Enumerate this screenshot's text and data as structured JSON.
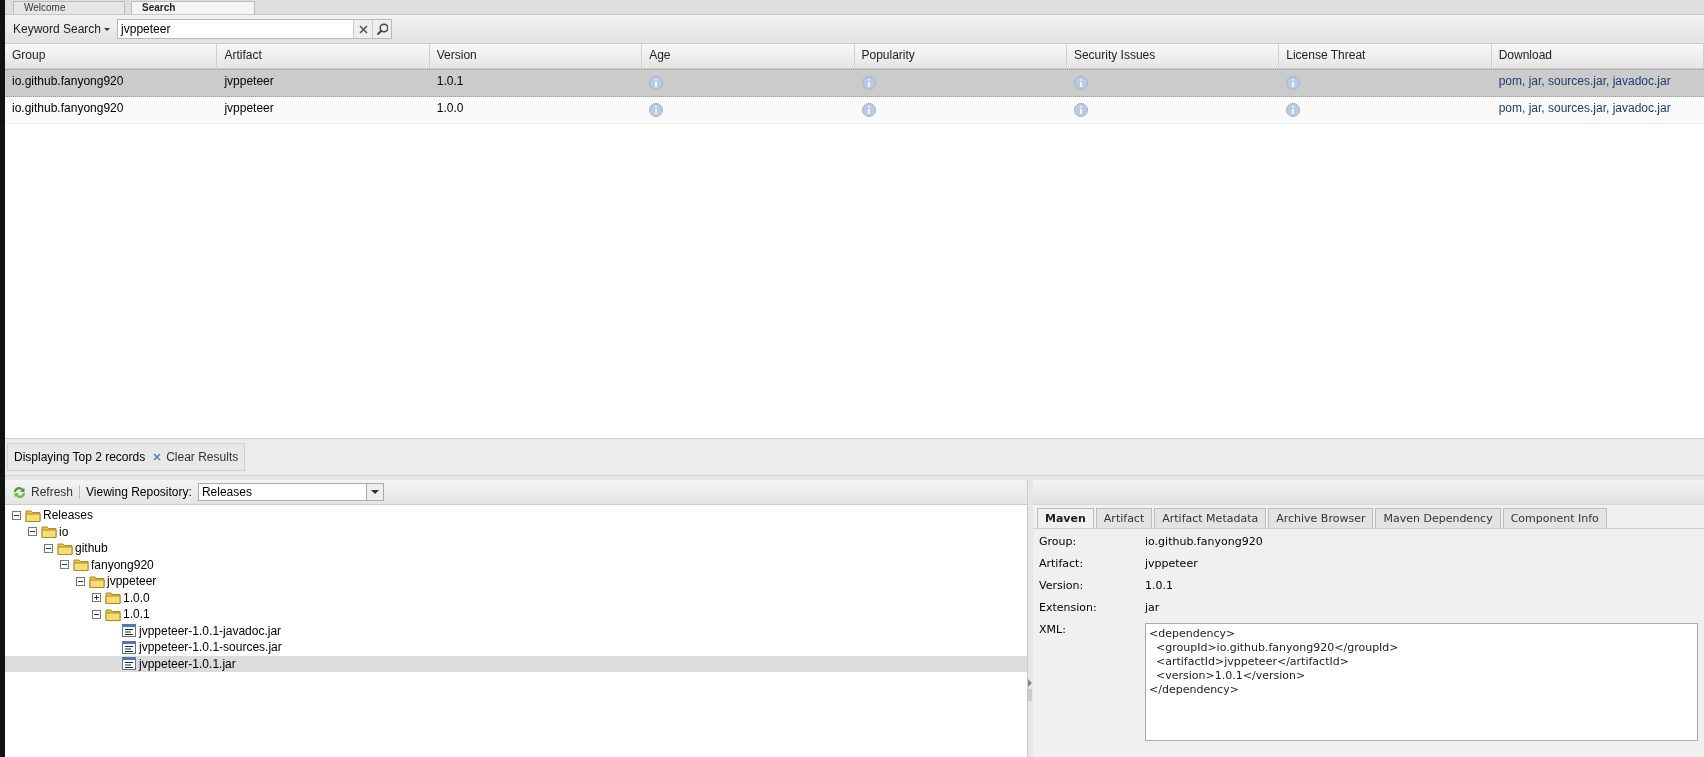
{
  "top_tabs": [
    {
      "label": "Welcome",
      "selected": false
    },
    {
      "label": "Search",
      "selected": true
    }
  ],
  "search": {
    "mode": "Keyword Search",
    "value": "jvppeteer"
  },
  "results": {
    "columns": [
      {
        "label": "Group",
        "kind": "text"
      },
      {
        "label": "Artifact",
        "kind": "text"
      },
      {
        "label": "Version",
        "kind": "text"
      },
      {
        "label": "Age",
        "kind": "info"
      },
      {
        "label": "Popularity",
        "kind": "info"
      },
      {
        "label": "Security Issues",
        "kind": "info"
      },
      {
        "label": "License Threat",
        "kind": "info"
      },
      {
        "label": "Download",
        "kind": "link"
      }
    ],
    "rows": [
      {
        "values": [
          "io.github.fanyong920",
          "jvppeteer",
          "1.0.1",
          "pom, jar, sources.jar, javadoc.jar"
        ],
        "selected": true
      },
      {
        "values": [
          "io.github.fanyong920",
          "jvppeteer",
          "1.0.0",
          "pom, jar, sources.jar, javadoc.jar"
        ],
        "selected": false
      }
    ]
  },
  "paging": {
    "status": "Displaying Top 2 records",
    "clear": "Clear Results"
  },
  "repository": {
    "refresh": "Refresh",
    "label": "Viewing Repository:",
    "value": "Releases"
  },
  "tree": [
    {
      "label": "Releases",
      "kind": "folder",
      "expanded": true,
      "selected": false,
      "children": [
        {
          "label": "io",
          "kind": "folder",
          "expanded": true,
          "selected": false,
          "children": [
            {
              "label": "github",
              "kind": "folder",
              "expanded": true,
              "selected": false,
              "children": [
                {
                  "label": "fanyong920",
                  "kind": "folder",
                  "expanded": true,
                  "selected": false,
                  "children": [
                    {
                      "label": "jvppeteer",
                      "kind": "folder",
                      "expanded": true,
                      "selected": false,
                      "children": [
                        {
                          "label": "1.0.0",
                          "kind": "folder",
                          "expanded": false,
                          "selected": false
                        },
                        {
                          "label": "1.0.1",
                          "kind": "folder",
                          "expanded": true,
                          "selected": false,
                          "children": [
                            {
                              "label": "jvppeteer-1.0.1-javadoc.jar",
                              "kind": "file",
                              "selected": false
                            },
                            {
                              "label": "jvppeteer-1.0.1-sources.jar",
                              "kind": "file",
                              "selected": false
                            },
                            {
                              "label": "jvppeteer-1.0.1.jar",
                              "kind": "file",
                              "selected": true
                            }
                          ]
                        }
                      ]
                    }
                  ]
                }
              ]
            }
          ]
        }
      ]
    }
  ],
  "detail": {
    "tabs": [
      {
        "label": "Maven",
        "selected": true
      },
      {
        "label": "Artifact",
        "selected": false
      },
      {
        "label": "Artifact Metadata",
        "selected": false
      },
      {
        "label": "Archive Browser",
        "selected": false
      },
      {
        "label": "Maven Dependency",
        "selected": false
      },
      {
        "label": "Component Info",
        "selected": false
      }
    ],
    "fields": [
      {
        "label": "Group:",
        "value": "io.github.fanyong920"
      },
      {
        "label": "Artifact:",
        "value": "jvppeteer"
      },
      {
        "label": "Version:",
        "value": "1.0.1"
      },
      {
        "label": "Extension:",
        "value": "jar"
      }
    ],
    "xml_label": "XML:",
    "xml": "<dependency>\n  <groupId>io.github.fanyong920</groupId>\n  <artifactId>jvppeteer</artifactId>\n  <version>1.0.1</version>\n</dependency>"
  }
}
